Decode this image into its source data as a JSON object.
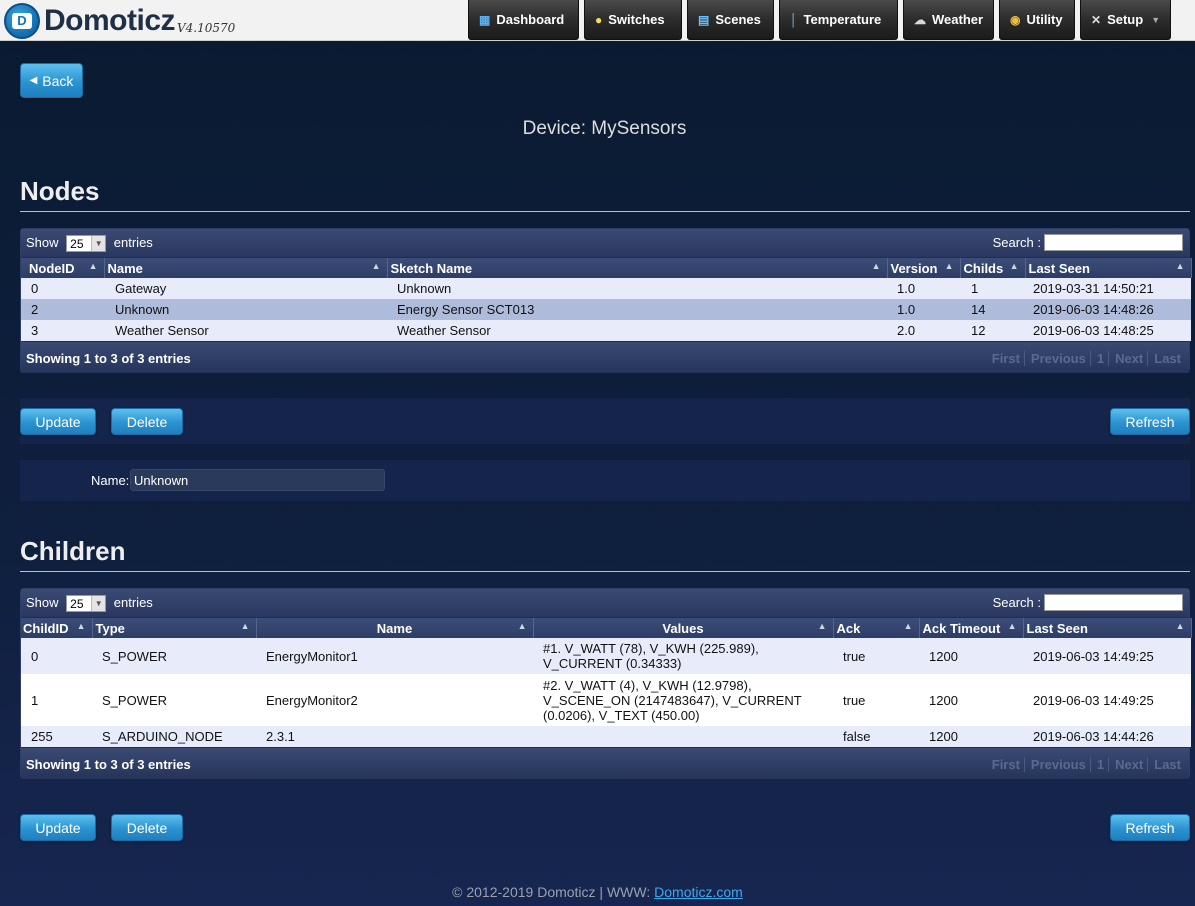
{
  "header": {
    "app_name": "Domoticz",
    "version": "V4.10570",
    "nav": [
      {
        "label": "Dashboard",
        "icon": "dashboard-icon"
      },
      {
        "label": "Switches",
        "icon": "lightbulb-icon"
      },
      {
        "label": "Scenes",
        "icon": "scene-icon"
      },
      {
        "label": "Temperature",
        "icon": "thermometer-icon"
      },
      {
        "label": "Weather",
        "icon": "cloud-icon"
      },
      {
        "label": "Utility",
        "icon": "utility-icon"
      },
      {
        "label": "Setup",
        "icon": "wrench-icon"
      }
    ]
  },
  "back_label": "Back",
  "device_title": "Device: MySensors",
  "nodes": {
    "title": "Nodes",
    "show_label": "Show",
    "entries_label": "entries",
    "page_size": "25",
    "search_label": "Search :",
    "columns": [
      "NodeID",
      "Name",
      "Sketch Name",
      "Version",
      "Childs",
      "Last Seen"
    ],
    "rows": [
      {
        "id": "0",
        "name": "Gateway",
        "sketch": "Unknown",
        "version": "1.0",
        "childs": "1",
        "last_seen": "2019-03-31 14:50:21"
      },
      {
        "id": "2",
        "name": "Unknown",
        "sketch": "Energy Sensor SCT013",
        "version": "1.0",
        "childs": "14",
        "last_seen": "2019-06-03 14:48:26"
      },
      {
        "id": "3",
        "name": "Weather Sensor",
        "sketch": "Weather Sensor",
        "version": "2.0",
        "childs": "12",
        "last_seen": "2019-06-03 14:48:25"
      }
    ],
    "showing": "Showing 1 to 3 of 3 entries",
    "pager": [
      "First",
      "Previous",
      "1",
      "Next",
      "Last"
    ],
    "update_label": "Update",
    "delete_label": "Delete",
    "refresh_label": "Refresh",
    "name_label": "Name:",
    "name_value": "Unknown"
  },
  "children": {
    "title": "Children",
    "show_label": "Show",
    "entries_label": "entries",
    "page_size": "25",
    "search_label": "Search :",
    "columns": [
      "ChildID",
      "Type",
      "Name",
      "Values",
      "Ack",
      "Ack Timeout",
      "Last Seen"
    ],
    "rows": [
      {
        "id": "0",
        "type": "S_POWER",
        "name": "EnergyMonitor1",
        "values": "#1. V_WATT (78), V_KWH (225.989), V_CURRENT (0.34333)",
        "ack": "true",
        "timeout": "1200",
        "last_seen": "2019-06-03 14:49:25"
      },
      {
        "id": "1",
        "type": "S_POWER",
        "name": "EnergyMonitor2",
        "values": "#2. V_WATT (4), V_KWH (12.9798), V_SCENE_ON (2147483647), V_CURRENT (0.0206), V_TEXT (450.00)",
        "ack": "true",
        "timeout": "1200",
        "last_seen": "2019-06-03 14:49:25"
      },
      {
        "id": "255",
        "type": "S_ARDUINO_NODE",
        "name": "2.3.1",
        "values": "",
        "ack": "false",
        "timeout": "1200",
        "last_seen": "2019-06-03 14:44:26"
      }
    ],
    "showing": "Showing 1 to 3 of 3 entries",
    "pager": [
      "First",
      "Previous",
      "1",
      "Next",
      "Last"
    ],
    "update_label": "Update",
    "delete_label": "Delete",
    "refresh_label": "Refresh"
  },
  "footer": {
    "text": "© 2012-2019 Domoticz | WWW: ",
    "link": "Domoticz.com"
  }
}
